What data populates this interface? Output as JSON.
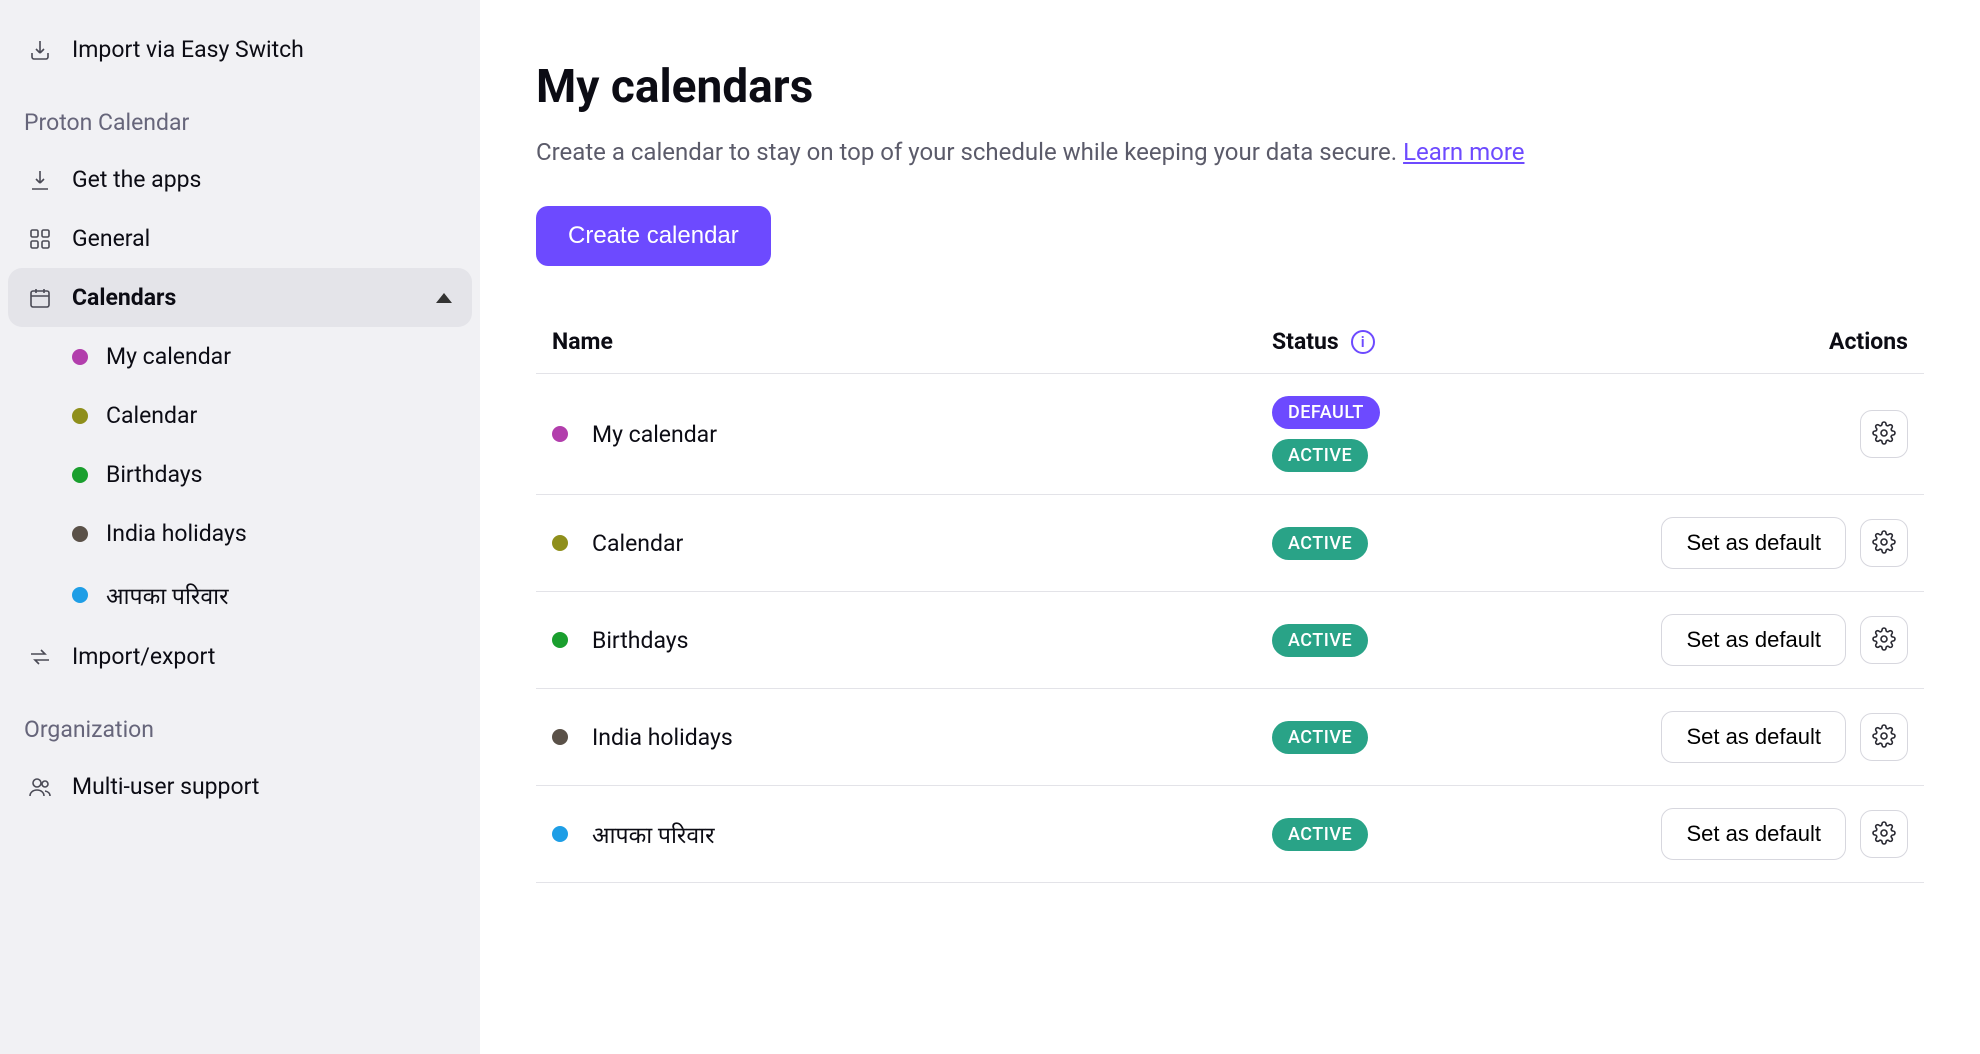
{
  "sidebar": {
    "import_switch": "Import via Easy Switch",
    "section_app": "Proton Calendar",
    "get_apps": "Get the apps",
    "general": "General",
    "calendars": "Calendars",
    "import_export": "Import/export",
    "section_org": "Organization",
    "multi_user": "Multi-user support",
    "calendar_list": [
      {
        "label": "My calendar",
        "color": "#b23eac"
      },
      {
        "label": "Calendar",
        "color": "#8f8f1b"
      },
      {
        "label": "Birthdays",
        "color": "#1a9f2e"
      },
      {
        "label": "India holidays",
        "color": "#5a5148"
      },
      {
        "label": "आपका परिवार",
        "color": "#1e9ee6"
      }
    ]
  },
  "main": {
    "title": "My calendars",
    "desc": "Create a calendar to stay on top of your schedule while keeping your data secure. ",
    "learn_more": "Learn more",
    "create_btn": "Create calendar",
    "columns": {
      "name": "Name",
      "status": "Status",
      "actions": "Actions"
    },
    "badges": {
      "default": "DEFAULT",
      "active": "ACTIVE"
    },
    "set_default": "Set as default",
    "rows": [
      {
        "label": "My calendar",
        "color": "#b23eac",
        "is_default": true,
        "active": true
      },
      {
        "label": "Calendar",
        "color": "#8f8f1b",
        "is_default": false,
        "active": true
      },
      {
        "label": "Birthdays",
        "color": "#1a9f2e",
        "is_default": false,
        "active": true
      },
      {
        "label": "India holidays",
        "color": "#5a5148",
        "is_default": false,
        "active": true
      },
      {
        "label": "आपका परिवार",
        "color": "#1e9ee6",
        "is_default": false,
        "active": true
      }
    ]
  }
}
